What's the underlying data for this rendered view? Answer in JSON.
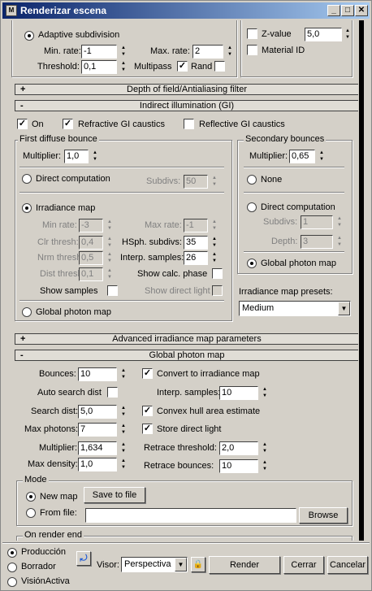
{
  "window": {
    "title": "Renderizar escena",
    "minimize": "_",
    "maximize": "□",
    "close": "✕"
  },
  "top": {
    "adaptive_subdivision": "Adaptive subdivision",
    "min_rate_label": "Min. rate:",
    "min_rate": "-1",
    "max_rate_label": "Max. rate:",
    "max_rate": "2",
    "threshold_label": "Threshold:",
    "threshold": "0,1",
    "multipass": "Multipass",
    "rand": "Rand",
    "zvalue": "Z-value",
    "zvalue_val": "5,0",
    "material_id": "Material ID"
  },
  "rollouts": {
    "dof": "Depth of field/Antialiasing filter",
    "gi": "Indirect illumination (GI)",
    "adv": "Advanced irradiance map parameters",
    "gpm": "Global photon map",
    "plus": "+",
    "minus": "-"
  },
  "gi": {
    "on": "On",
    "refractive": "Refractive GI caustics",
    "reflective": "Reflective GI caustics",
    "first": {
      "title": "First diffuse bounce",
      "multiplier_label": "Multiplier:",
      "multiplier": "1,0",
      "direct": "Direct computation",
      "subdivs_label": "Subdivs:",
      "subdivs": "50",
      "irradiance": "Irradiance map",
      "min_rate_label": "Min rate:",
      "min_rate": "-3",
      "max_rate_label": "Max rate:",
      "max_rate": "-1",
      "clr_label": "Clr thresh:",
      "clr": "0,4",
      "hsph_label": "HSph. subdivs:",
      "hsph": "35",
      "nrm_label": "Nrm thresh:",
      "nrm": "0,5",
      "interp_label": "Interp. samples:",
      "interp": "26",
      "dist_label": "Dist thresh:",
      "dist": "0,1",
      "show_calc": "Show calc. phase",
      "show_samples": "Show samples",
      "show_direct": "Show direct light",
      "global": "Global photon map"
    },
    "second": {
      "title": "Secondary bounces",
      "multiplier_label": "Multiplier:",
      "multiplier": "0,65",
      "none": "None",
      "direct": "Direct computation",
      "subdivs_label": "Subdivs:",
      "subdivs": "1",
      "depth_label": "Depth:",
      "depth": "3",
      "global": "Global photon map"
    },
    "presets_label": "Irradiance map presets:",
    "preset": "Medium"
  },
  "gpm": {
    "bounces_label": "Bounces:",
    "bounces": "10",
    "auto_search": "Auto search dist",
    "search_label": "Search dist:",
    "search": "5,0",
    "max_photons_label": "Max photons:",
    "max_photons": "7",
    "multiplier_label": "Multiplier:",
    "multiplier": "1,634",
    "max_density_label": "Max density:",
    "max_density": "1,0",
    "convert": "Convert to irradiance map",
    "interp_label": "Interp. samples:",
    "interp": "10",
    "convex": "Convex hull area estimate",
    "store": "Store direct light",
    "retrace_thr_label": "Retrace threshold:",
    "retrace_thr": "2,0",
    "retrace_bnc_label": "Retrace bounces:",
    "retrace_bnc": "10",
    "mode_title": "Mode",
    "new_map": "New map",
    "save_to_file": "Save to file",
    "from_file": "From file:",
    "browse": "Browse",
    "on_render_end": "On render end"
  },
  "bottom": {
    "produccion": "Producción",
    "borrador": "Borrador",
    "visionactiva": "VisiónActiva",
    "visor_label": "Visor:",
    "visor": "Perspectiva",
    "render": "Render",
    "cerrar": "Cerrar",
    "cancelar": "Cancelar"
  }
}
